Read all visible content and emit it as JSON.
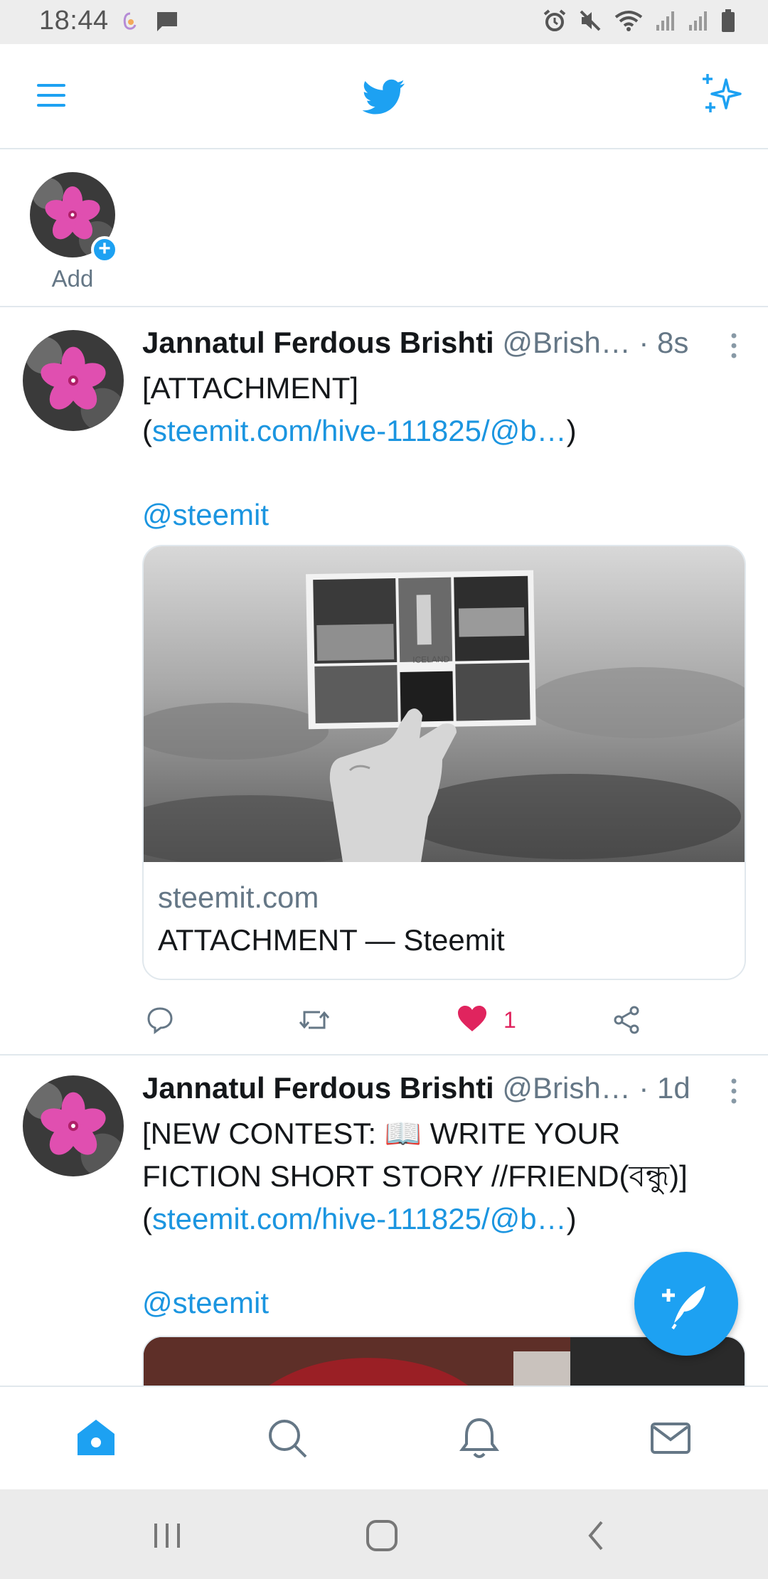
{
  "status_bar": {
    "time": "18:44",
    "icons": [
      "notification-app-icon",
      "message-icon",
      "alarm-icon",
      "mute-icon",
      "wifi-icon",
      "signal-icon",
      "signal-icon",
      "battery-icon"
    ]
  },
  "app_bar": {
    "menu_icon": "menu-icon",
    "logo_icon": "twitter-bird-icon",
    "sparkle_icon": "sparkle-icon",
    "accent": "#1DA1F2"
  },
  "fleets": {
    "add_label": "Add"
  },
  "tweets": [
    {
      "name": "Jannatul Ferdous Brishti",
      "handle": "@Brish…",
      "time": "· 8s",
      "text_prefix": "[ATTACHMENT](",
      "link": "steemit.com/hive‑111825/@b…",
      "text_suffix": ")",
      "mention": "@steemit",
      "card": {
        "domain": "steemit.com",
        "title": "ATTACHMENT — Steemit",
        "image_caption": "ICELAND"
      },
      "likes": "1",
      "liked": true
    },
    {
      "name": "Jannatul Ferdous Brishti",
      "handle": "@Brish…",
      "time": "· 1d",
      "text_prefix": "[NEW CONTEST: 📖 WRITE YOUR FICTION SHORT STORY //FRIEND(বন্ধু)](",
      "link": "steemit.com/hive-111825/@b…",
      "text_suffix": ")",
      "mention": "@steemit"
    }
  ],
  "bottom_nav": [
    "home-icon",
    "search-icon",
    "bell-icon",
    "mail-icon"
  ],
  "colors": {
    "blue": "#1DA1F2",
    "link": "#1B95E0",
    "like": "#E0245E",
    "secondary_text": "#657786"
  }
}
